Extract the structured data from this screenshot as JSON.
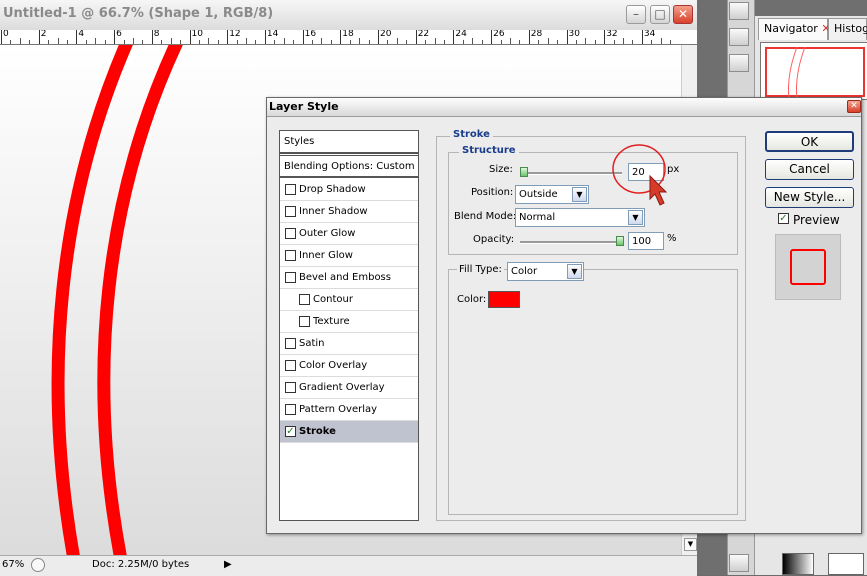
{
  "document": {
    "title": "Untitled-1 @ 66.7% (Shape 1, RGB/8)",
    "ruler_labels": [
      "0",
      "2",
      "4",
      "6",
      "8",
      "10",
      "12",
      "14",
      "16",
      "18",
      "20",
      "22",
      "24",
      "26",
      "28",
      "30",
      "32",
      "34"
    ],
    "zoom": "67%",
    "doc_info": "Doc: 2.25M/0 bytes"
  },
  "panels": {
    "navigator_tab": "Navigator",
    "histogram_tab": "Histogra"
  },
  "dialog": {
    "title": "Layer Style",
    "styles_list": {
      "header": "Styles",
      "blending": "Blending Options: Custom",
      "items": [
        {
          "label": "Drop Shadow",
          "checked": false
        },
        {
          "label": "Inner Shadow",
          "checked": false
        },
        {
          "label": "Outer Glow",
          "checked": false
        },
        {
          "label": "Inner Glow",
          "checked": false
        },
        {
          "label": "Bevel and Emboss",
          "checked": false
        },
        {
          "label": "Contour",
          "checked": false
        },
        {
          "label": "Texture",
          "checked": false
        },
        {
          "label": "Satin",
          "checked": false
        },
        {
          "label": "Color Overlay",
          "checked": false
        },
        {
          "label": "Gradient Overlay",
          "checked": false
        },
        {
          "label": "Pattern Overlay",
          "checked": false
        },
        {
          "label": "Stroke",
          "checked": true
        }
      ]
    },
    "stroke": {
      "group_title": "Stroke",
      "structure_title": "Structure",
      "size_label": "Size:",
      "size_value": "20",
      "size_unit": "px",
      "size_fraction": 0.02,
      "position_label": "Position:",
      "position_value": "Outside",
      "blend_label": "Blend Mode:",
      "blend_value": "Normal",
      "opacity_label": "Opacity:",
      "opacity_value": "100",
      "opacity_unit": "%",
      "opacity_fraction": 1.0,
      "fill_type_label": "Fill Type:",
      "fill_type_value": "Color",
      "color_label": "Color:",
      "color_value": "#ff0000"
    },
    "buttons": {
      "ok": "OK",
      "cancel": "Cancel",
      "new_style": "New Style...",
      "preview_label": "Preview",
      "preview_checked": true
    }
  },
  "colors": {
    "stroke_red": "#ff0000",
    "annotation_red": "#e02020"
  }
}
